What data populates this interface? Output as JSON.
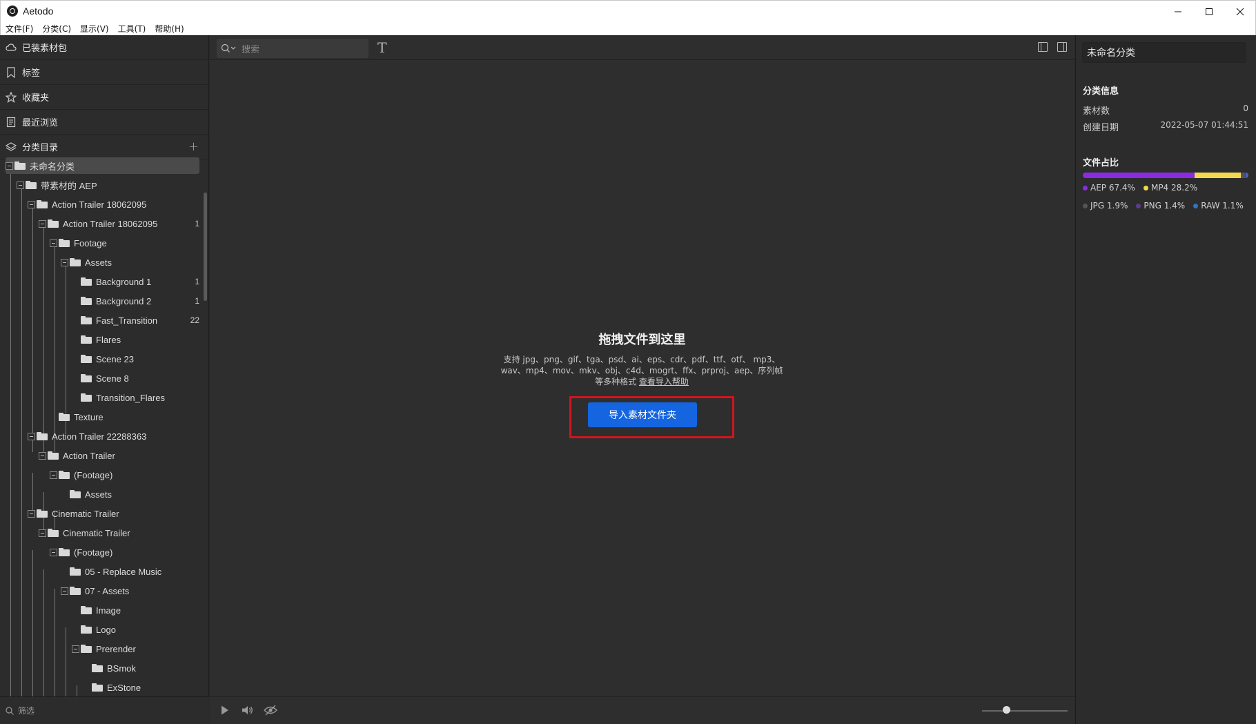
{
  "window": {
    "title": "Aetodo"
  },
  "menu": [
    {
      "label": "文件(F)"
    },
    {
      "label": "分类(C)"
    },
    {
      "label": "显示(V)"
    },
    {
      "label": "工具(T)"
    },
    {
      "label": "帮助(H)"
    }
  ],
  "sidebar": {
    "nav": [
      {
        "label": "已装素材包",
        "icon": "cloud-icon"
      },
      {
        "label": "标签",
        "icon": "tag-icon"
      },
      {
        "label": "收藏夹",
        "icon": "star-icon"
      },
      {
        "label": "最近浏览",
        "icon": "recent-icon"
      },
      {
        "label": "分类目录",
        "icon": "layers-icon"
      }
    ],
    "add_label": "+",
    "tree": [
      {
        "label": "未命名分类",
        "count": "",
        "selected": true
      },
      {
        "label": "带素材的 AEP",
        "count": ""
      },
      {
        "label": "Action Trailer 18062095",
        "count": ""
      },
      {
        "label": "Action Trailer 18062095",
        "count": "1"
      },
      {
        "label": "Footage",
        "count": ""
      },
      {
        "label": "Assets",
        "count": ""
      },
      {
        "label": "Background 1",
        "count": "1"
      },
      {
        "label": "Background 2",
        "count": "1"
      },
      {
        "label": "Fast_Transition",
        "count": "22"
      },
      {
        "label": "Flares",
        "count": ""
      },
      {
        "label": "Scene 23",
        "count": ""
      },
      {
        "label": "Scene 8",
        "count": ""
      },
      {
        "label": "Transition_Flares",
        "count": ""
      },
      {
        "label": "Texture",
        "count": ""
      },
      {
        "label": "Action Trailer 22288363",
        "count": ""
      },
      {
        "label": "Action Trailer",
        "count": ""
      },
      {
        "label": "(Footage)",
        "count": ""
      },
      {
        "label": "Assets",
        "count": ""
      },
      {
        "label": "Cinematic Trailer",
        "count": ""
      },
      {
        "label": "Cinematic Trailer",
        "count": ""
      },
      {
        "label": "(Footage)",
        "count": ""
      },
      {
        "label": "05 - Replace Music",
        "count": ""
      },
      {
        "label": "07 - Assets",
        "count": ""
      },
      {
        "label": "Image",
        "count": ""
      },
      {
        "label": "Logo",
        "count": ""
      },
      {
        "label": "Prerender",
        "count": ""
      },
      {
        "label": "BSmok",
        "count": ""
      },
      {
        "label": "ExStone",
        "count": ""
      }
    ],
    "filter_placeholder": "筛选"
  },
  "main": {
    "search_placeholder": "搜索",
    "drop_title": "拖拽文件到这里",
    "drop_desc_line1": "支持 jpg、png、gif、tga、psd、ai、eps、cdr、pdf、ttf、otf、 mp3、",
    "drop_desc_line2": "wav、mp4、mov、mkv、obj、c4d、mogrt、ffx、prproj、aep、序列帧",
    "drop_desc_line3_prefix": "等多种格式 ",
    "drop_desc_help_link": "查看导入帮助",
    "import_button": "导入素材文件夹",
    "zoom_level": 0.28
  },
  "right_panel": {
    "category_name": "未命名分类",
    "info_title": "分类信息",
    "asset_count_label": "素材数",
    "asset_count_value": "0",
    "created_label": "创建日期",
    "created_value": "2022-05-07 01:44:51",
    "ratio_title": "文件占比",
    "ratios": [
      {
        "label": "AEP 67.4%",
        "pct": 67.4,
        "color": "#8a2be2"
      },
      {
        "label": "MP4 28.2%",
        "pct": 28.2,
        "color": "#f2d94e"
      },
      {
        "label": "JPG 1.9%",
        "pct": 1.9,
        "color": "#555555"
      },
      {
        "label": "PNG 1.4%",
        "pct": 1.4,
        "color": "#5b3d8f"
      },
      {
        "label": "RAW 1.1%",
        "pct": 1.1,
        "color": "#2f74c0"
      }
    ]
  }
}
